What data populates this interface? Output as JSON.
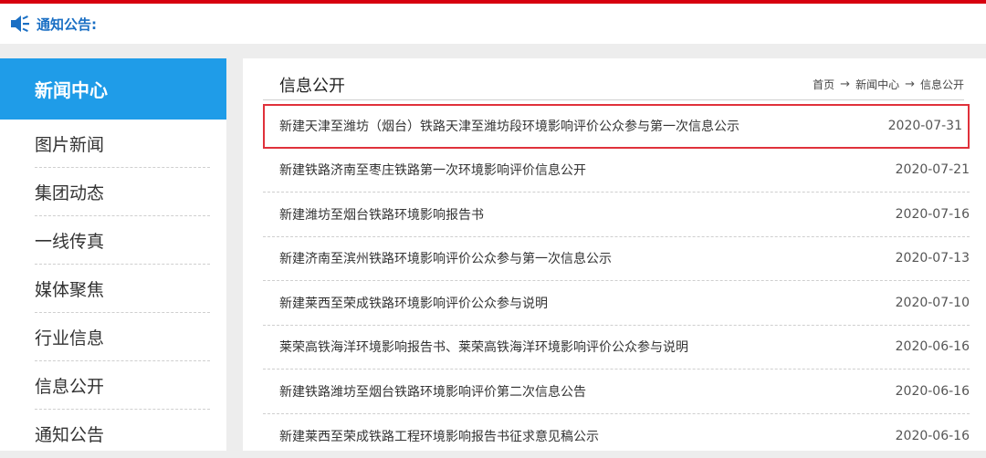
{
  "notice": {
    "label": "通知公告:",
    "icon": "speaker-icon"
  },
  "sidebar": {
    "header": "新闻中心",
    "items": [
      {
        "label": "图片新闻"
      },
      {
        "label": "集团动态"
      },
      {
        "label": "一线传真"
      },
      {
        "label": "媒体聚焦"
      },
      {
        "label": "行业信息"
      },
      {
        "label": "信息公开"
      },
      {
        "label": "通知公告"
      }
    ]
  },
  "main": {
    "title": "信息公开",
    "breadcrumb": [
      "首页",
      "新闻中心",
      "信息公开"
    ],
    "news": [
      {
        "title": "新建天津至潍坊（烟台）铁路天津至潍坊段环境影响评价公众参与第一次信息公示",
        "date": "2020-07-31"
      },
      {
        "title": "新建铁路济南至枣庄铁路第一次环境影响评价信息公开",
        "date": "2020-07-21"
      },
      {
        "title": "新建潍坊至烟台铁路环境影响报告书",
        "date": "2020-07-16"
      },
      {
        "title": "新建济南至滨州铁路环境影响评价公众参与第一次信息公示",
        "date": "2020-07-13"
      },
      {
        "title": "新建莱西至荣成铁路环境影响评价公众参与说明",
        "date": "2020-07-10"
      },
      {
        "title": "莱荣高铁海洋环境影响报告书、莱荣高铁海洋环境影响评价公众参与说明",
        "date": "2020-06-16"
      },
      {
        "title": "新建铁路潍坊至烟台铁路环境影响评价第二次信息公告",
        "date": "2020-06-16"
      },
      {
        "title": "新建莱西至荣成铁路工程环境影响报告书征求意见稿公示",
        "date": "2020-06-16"
      }
    ]
  },
  "colors": {
    "accent_red": "#d7000f",
    "sidebar_blue": "#1f9ce8",
    "notice_blue": "#1a6fc4",
    "highlight_red": "#e0313b"
  }
}
